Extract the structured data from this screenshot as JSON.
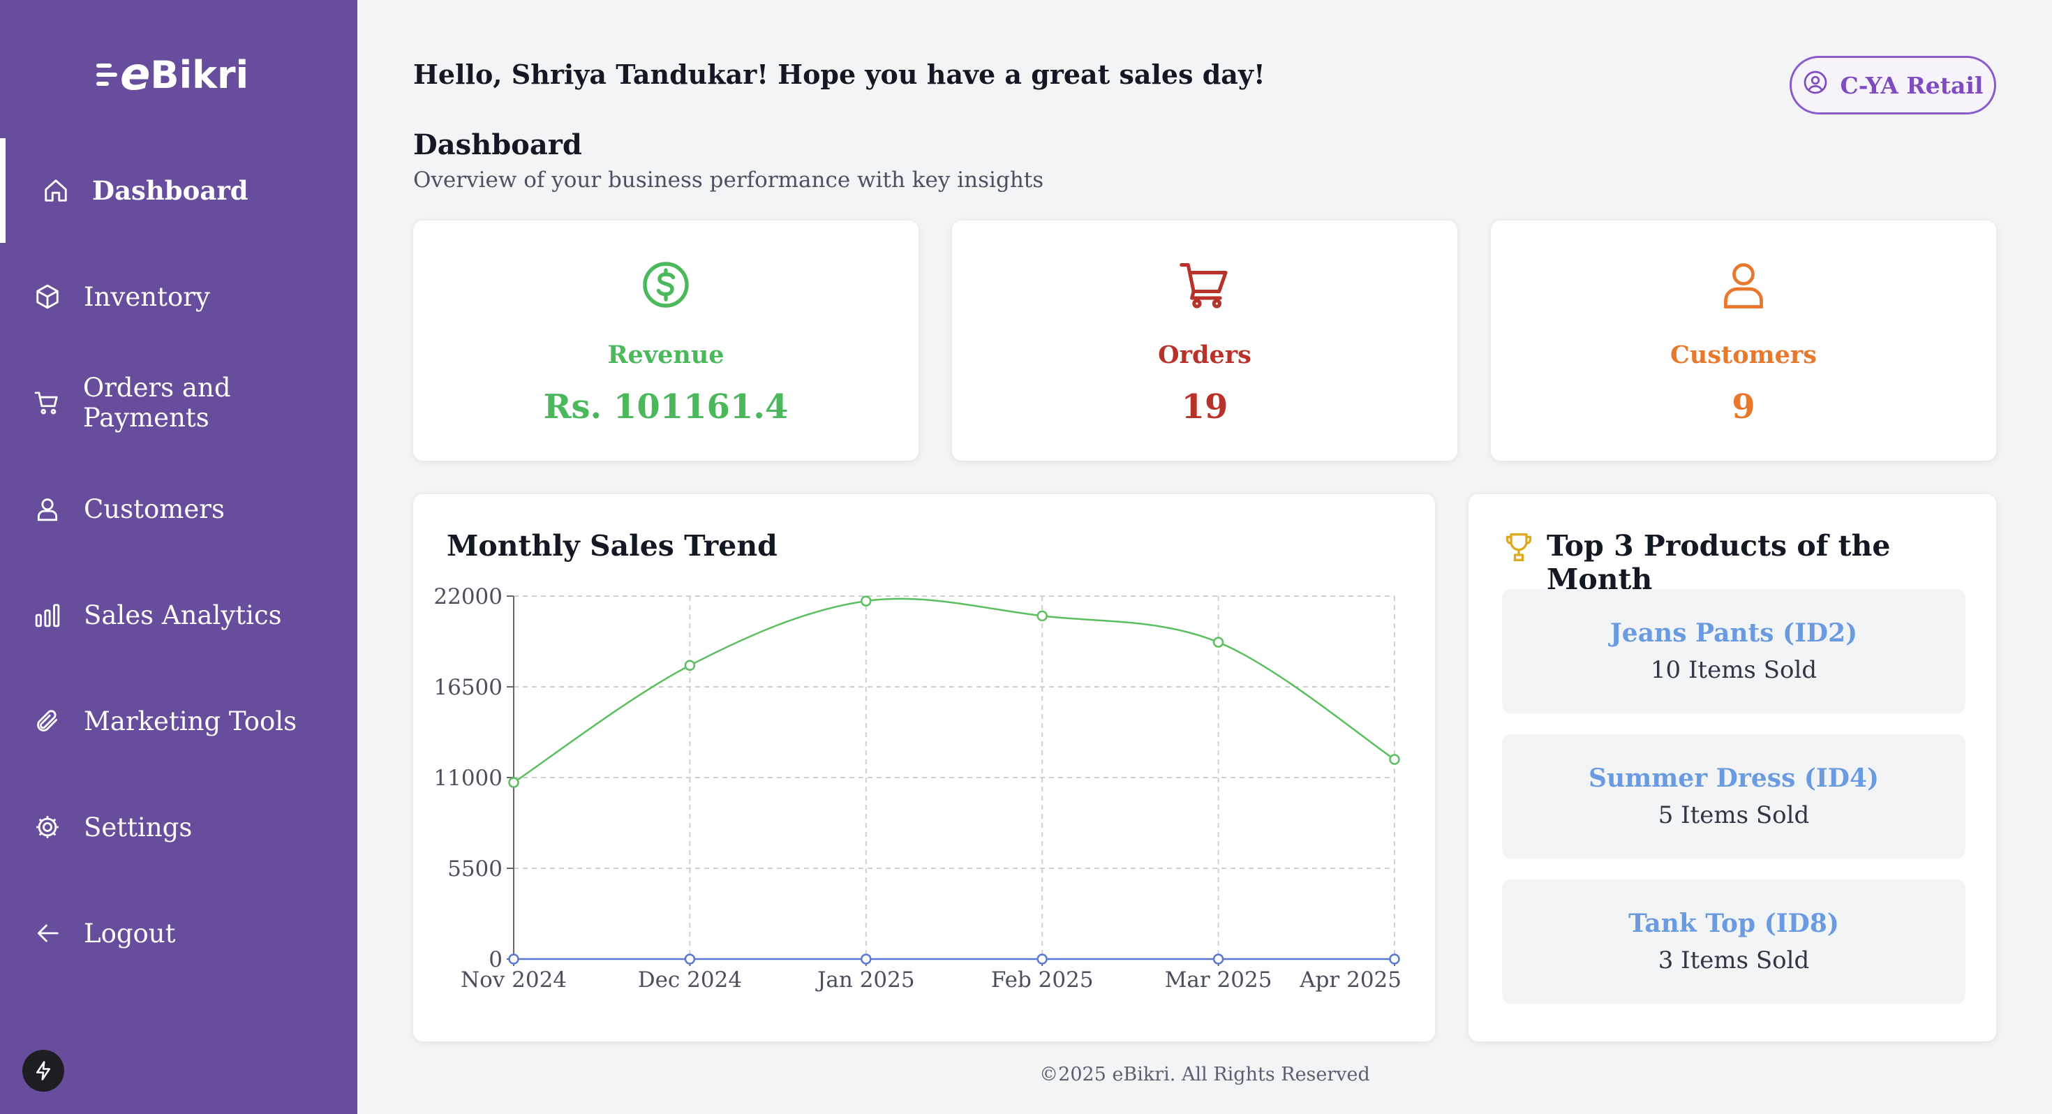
{
  "brand": {
    "logo_e": "e",
    "logo_rest": "Bikri"
  },
  "sidebar": {
    "items": [
      {
        "label": "Dashboard",
        "icon": "home-icon",
        "active": true
      },
      {
        "label": "Inventory",
        "icon": "box-icon"
      },
      {
        "label": "Orders and Payments",
        "icon": "cart-icon"
      },
      {
        "label": "Customers",
        "icon": "user-icon"
      },
      {
        "label": "Sales Analytics",
        "icon": "bar-chart-icon"
      },
      {
        "label": "Marketing Tools",
        "icon": "paperclip-icon"
      },
      {
        "label": "Settings",
        "icon": "gear-icon"
      },
      {
        "label": "Logout",
        "icon": "arrow-left-icon"
      }
    ],
    "bolt_icon": "lightning-icon"
  },
  "header": {
    "greeting": "Hello, Shriya Tandukar! Hope you have a great sales day!",
    "store_label": "C-YA Retail",
    "store_icon": "user-circle-icon"
  },
  "page": {
    "title": "Dashboard",
    "subtitle": "Overview of your business performance with key insights"
  },
  "stats": [
    {
      "label": "Revenue",
      "value": "Rs. 101161.4",
      "icon": "dollar-circle-icon",
      "color": "#4cb85c"
    },
    {
      "label": "Orders",
      "value": "19",
      "icon": "cart-icon",
      "color": "#b8322a"
    },
    {
      "label": "Customers",
      "value": "9",
      "icon": "user-icon",
      "color": "#e8782c"
    }
  ],
  "chart": {
    "title": "Monthly Sales Trend"
  },
  "chart_data": {
    "type": "line",
    "title": "Monthly Sales Trend",
    "xlabel": "",
    "ylabel": "",
    "categories": [
      "Nov 2024",
      "Dec 2024",
      "Jan 2025",
      "Feb 2025",
      "Mar 2025",
      "Apr 2025"
    ],
    "y_ticks": [
      "0",
      "5500",
      "11000",
      "16500",
      "22000"
    ],
    "ylim": [
      0,
      22000
    ],
    "grid": true,
    "series": [
      {
        "values": [
          10700,
          17800,
          21700,
          20800,
          19200,
          12100
        ],
        "color": "#5bbf5f"
      },
      {
        "values": [
          0,
          0,
          0,
          0,
          0,
          0
        ],
        "color": "#5a78d6"
      }
    ]
  },
  "top_products": {
    "title": "Top 3 Products of the Month",
    "icon": "trophy-icon",
    "items": [
      {
        "name": "Jeans Pants (ID2)",
        "sold": "10 Items Sold"
      },
      {
        "name": "Summer Dress (ID4)",
        "sold": "5 Items Sold"
      },
      {
        "name": "Tank Top (ID8)",
        "sold": "3 Items Sold"
      }
    ]
  },
  "footer": {
    "text": "©2025 eBikri. All Rights Reserved"
  }
}
